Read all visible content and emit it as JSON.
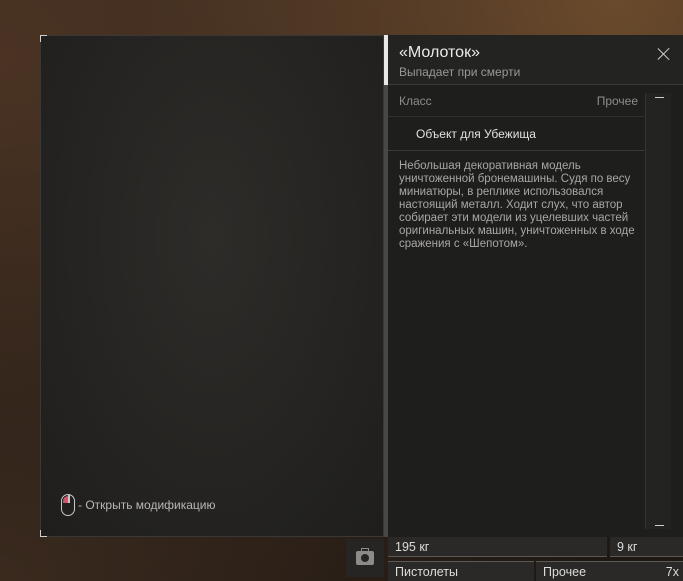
{
  "preview": {
    "mod_hint": "- Открыть модификацию"
  },
  "item": {
    "title": "«Молоток»",
    "subtitle": "Выпадает при смерти",
    "class_label": "Класс",
    "class_value": "Прочее",
    "type": "Объект для Убежища",
    "description": "Небольшая декоративная модель уничтоженной бронемашины. Судя по весу миниатюры, в реплике использовался настоящий металл. Ходит слух, что автор собирает эти модели из уцелевших частей оригинальных машин, уничтоженных в ходе сражения с «Шепотом»."
  },
  "inventory": {
    "weight_total": "195 кг",
    "weight_item": "9 кг",
    "category_left": "Пистолеты",
    "category_right": "Прочее",
    "count": "7x"
  },
  "icons": {
    "close": "close-icon",
    "mouse": "mouse-icon",
    "medkit": "medkit-icon"
  },
  "colors": {
    "accent_mouse": "#d2536a",
    "panel": "#1e1e1d"
  }
}
